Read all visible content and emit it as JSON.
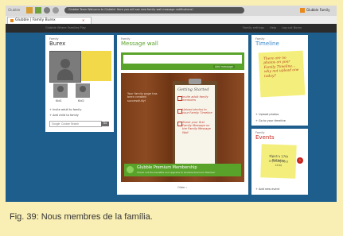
{
  "browser": {
    "app_label": "Glubble",
    "address_text": "Glubble Team  Welcome to Glubble! Here you will see new family wall message notifications!",
    "extension_label": "Glubble Family",
    "tab_title": "Glubble | Family Burex",
    "tab_close": "✕"
  },
  "appbar": {
    "left_text": "Glubble  Where Families Play",
    "links": [
      "Family settings",
      "Help",
      "Log out Burex"
    ]
  },
  "family": {
    "label": "Family",
    "name": "Burex",
    "kid1": "Kid1",
    "kid2": "Kid2",
    "invite": "+ Invite adult to family",
    "add_child": "+ Add child to family",
    "search_placeholder": "Google  Custom Search",
    "search_button": "Go"
  },
  "wall": {
    "label": "Family",
    "title": "Message wall",
    "add_message": "Add message",
    "empty_note": "Your family page has been created successfully!",
    "clipboard_title": "Getting Started",
    "checklist": [
      "Invite adult family members",
      "Upload photos to your Family Timeline",
      "Share your first Family Message on the Family Message Wall"
    ],
    "premium_title": "Glubble Premium Membership",
    "premium_sub": "Check out the benefits and upgrade to Glubble Premium Member",
    "older_link": "Older ›"
  },
  "timeline": {
    "label": "Family",
    "title": "Timeline",
    "note": "There are no photos on your Family Timeline... why not upload one today?",
    "upload": "+ Upload photos",
    "goto": "+ Go to your timeline"
  },
  "events": {
    "label": "Family",
    "title": "Events",
    "note_title": "Kipo1's 17th Birthday",
    "note_date": "20 January 2013",
    "note_time": "12:00",
    "add_event": "+ Add new event"
  },
  "caption": "Fig. 39: Nous membres de la família.",
  "colors": {
    "accent_green": "#5aa32b",
    "timeline_blue": "#3a89c9",
    "events_red": "#c8261f",
    "background": "#1e5e8c"
  }
}
